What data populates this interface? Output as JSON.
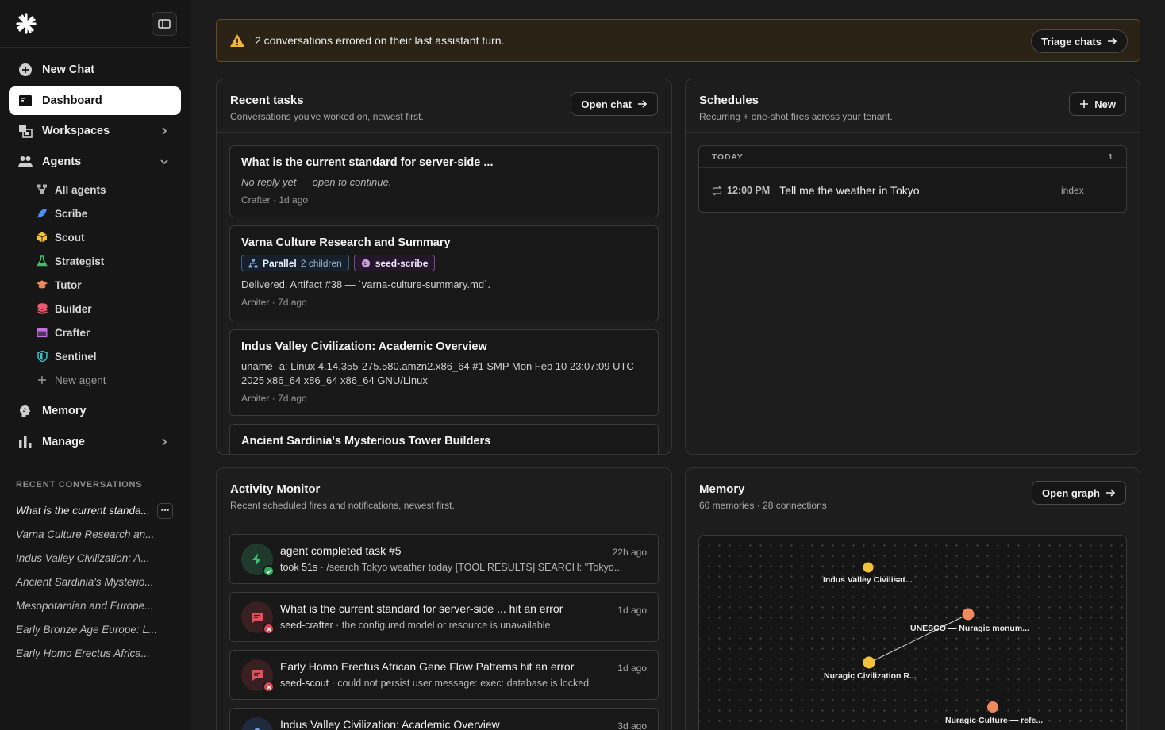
{
  "sidebar": {
    "nav": {
      "new_chat": "New Chat",
      "dashboard": "Dashboard",
      "workspaces": "Workspaces",
      "agents": "Agents",
      "memory": "Memory",
      "manage": "Manage"
    },
    "agents": [
      {
        "label": "All agents",
        "icon": "agents-grid-icon",
        "color": "#b0b0b0"
      },
      {
        "label": "Scribe",
        "icon": "feather-icon",
        "color": "#4f8ff7"
      },
      {
        "label": "Scout",
        "icon": "cube-icon",
        "color": "#f3c13a"
      },
      {
        "label": "Strategist",
        "icon": "flask-icon",
        "color": "#3fbf6a"
      },
      {
        "label": "Tutor",
        "icon": "graduation-cap-icon",
        "color": "#f08a5d"
      },
      {
        "label": "Builder",
        "icon": "database-icon",
        "color": "#ef5a6f"
      },
      {
        "label": "Crafter",
        "icon": "window-icon",
        "color": "#c46ee0"
      },
      {
        "label": "Sentinel",
        "icon": "shield-icon",
        "color": "#3cc1c9"
      }
    ],
    "new_agent": "New agent",
    "recent_heading": "RECENT CONVERSATIONS",
    "recent": [
      "What is the current standa...",
      "Varna Culture Research an...",
      "Indus Valley Civilization: A...",
      "Ancient Sardinia's Mysterio...",
      "Mesopotamian and Europe...",
      "Early Bronze Age Europe: L...",
      "Early Homo Erectus Africa..."
    ],
    "more_label": "•••"
  },
  "banner": {
    "text": "2 conversations errored on their last assistant turn.",
    "button": "Triage chats"
  },
  "recent_tasks": {
    "title": "Recent tasks",
    "subtitle": "Conversations you've worked on, newest first.",
    "button": "Open chat",
    "tasks": [
      {
        "title": "What is the current standard for server-side ...",
        "body": "No reply yet — open to continue.",
        "agent": "Crafter",
        "time": "1d ago"
      },
      {
        "title": "Varna Culture Research and Summary",
        "tag_parallel": "Parallel",
        "tag_children": "2 children",
        "tag_seed": "seed-scribe",
        "body": "Delivered. Artifact #38 — `varna-culture-summary.md`.",
        "agent": "Arbiter",
        "time": "7d ago"
      },
      {
        "title": "Indus Valley Civilization: Academic Overview",
        "body": "uname -a: Linux 4.14.355-275.580.amzn2.x86_64 #1 SMP Mon Feb 10 23:07:09 UTC 2025 x86_64 x86_64 x86_64 GNU/Linux",
        "agent": "Arbiter",
        "time": "7d ago"
      },
      {
        "title": "Ancient Sardinia's Mysterious Tower Builders"
      }
    ]
  },
  "schedules": {
    "title": "Schedules",
    "subtitle": "Recurring + one-shot fires across your tenant.",
    "button": "New",
    "group": "TODAY",
    "count": "1",
    "item": {
      "time": "12:00 PM",
      "title": "Tell me the weather in Tokyo",
      "agent": "index"
    }
  },
  "activity": {
    "title": "Activity Monitor",
    "subtitle": "Recent scheduled fires and notifications, newest first.",
    "items": [
      {
        "title": "agent completed task #5",
        "time": "22h ago",
        "who": "took 51s",
        "detail": "/search Tokyo weather today [TOOL RESULTS] SEARCH: \"Tokyo..."
      },
      {
        "title": "What is the current standard for server-side ... hit an error",
        "time": "1d ago",
        "who": "seed-crafter",
        "detail": "the configured model or resource is unavailable"
      },
      {
        "title": "Early Homo Erectus African Gene Flow Patterns hit an error",
        "time": "1d ago",
        "who": "seed-scout",
        "detail": "could not persist user message: exec: database is locked"
      },
      {
        "title": "Indus Valley Civilization: Academic Overview",
        "time": "3d ago"
      }
    ]
  },
  "memory": {
    "title": "Memory",
    "subtitle": "60 memories · 28 connections",
    "button": "Open graph",
    "nodes": [
      {
        "label": "Indus Valley Civilisat...",
        "color": "#f3c13a"
      },
      {
        "label": "UNESCO — Nuragic monum...",
        "color": "#f08a5d"
      },
      {
        "label": "Nuragic Civilization R...",
        "color": "#f3c13a"
      },
      {
        "label": "Nuragic Culture — refe...",
        "color": "#f08a5d"
      }
    ]
  }
}
